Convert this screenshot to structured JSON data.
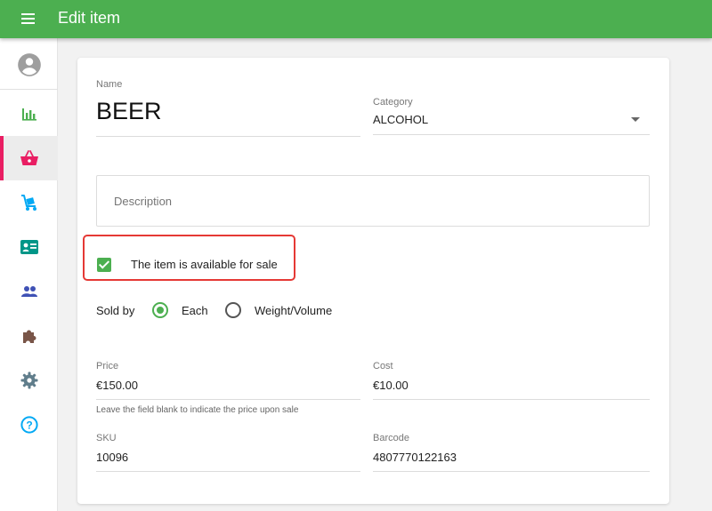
{
  "header": {
    "title": "Edit item"
  },
  "sidebar": {
    "items": [
      {
        "icon": "account-circle-icon",
        "color": "#9e9e9e"
      },
      {
        "icon": "bar-chart-icon",
        "color": "#4caf50"
      },
      {
        "icon": "basket-icon",
        "color": "#e91e63",
        "active": true
      },
      {
        "icon": "cart-hand-truck-icon",
        "color": "#03a9f4"
      },
      {
        "icon": "id-card-icon",
        "color": "#009688"
      },
      {
        "icon": "people-icon",
        "color": "#3f51b5"
      },
      {
        "icon": "puzzle-icon",
        "color": "#795548"
      },
      {
        "icon": "gear-icon",
        "color": "#607d8b"
      },
      {
        "icon": "help-circle-icon",
        "color": "#03a9f4"
      }
    ]
  },
  "form": {
    "name_label": "Name",
    "name_value": "BEER",
    "category_label": "Category",
    "category_value": "ALCOHOL",
    "description_placeholder": "Description",
    "available_label": "The item is available for sale",
    "available_checked": true,
    "sold_by_label": "Sold by",
    "sold_by_options": [
      "Each",
      "Weight/Volume"
    ],
    "sold_by_selected": "Each",
    "price_label": "Price",
    "price_value": "€150.00",
    "price_hint": "Leave the field blank to indicate the price upon sale",
    "cost_label": "Cost",
    "cost_value": "€10.00",
    "sku_label": "SKU",
    "sku_value": "10096",
    "barcode_label": "Barcode",
    "barcode_value": "4807770122163"
  },
  "colors": {
    "accent": "#4caf50",
    "active_nav": "#e91e63",
    "highlight": "#e53935"
  }
}
